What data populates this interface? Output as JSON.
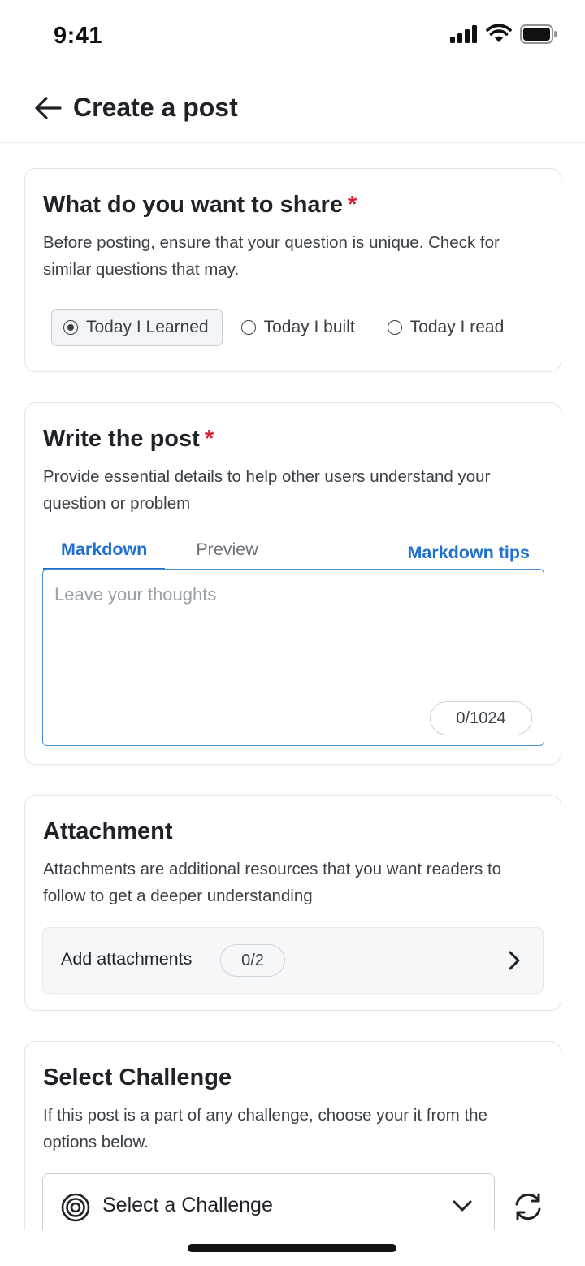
{
  "status_bar": {
    "time": "9:41"
  },
  "header": {
    "title": "Create a post"
  },
  "share_section": {
    "title": "What do you want to share",
    "required_mark": "*",
    "description": "Before posting, ensure that your question is unique. Check for similar questions that may.",
    "options": [
      {
        "label": "Today I Learned",
        "selected": true
      },
      {
        "label": "Today I built",
        "selected": false
      },
      {
        "label": "Today I read",
        "selected": false
      }
    ]
  },
  "write_section": {
    "title": "Write the post",
    "required_mark": "*",
    "description": "Provide essential details to help other users understand your question or problem",
    "tabs": [
      {
        "label": "Markdown",
        "active": true
      },
      {
        "label": "Preview",
        "active": false
      }
    ],
    "tips_link": "Markdown tips",
    "editor": {
      "value": "",
      "placeholder": "Leave your thoughts"
    },
    "char_count": "0/1024"
  },
  "attachment_section": {
    "title": "Attachment",
    "description": "Attachments are additional resources that you want readers to follow to get a deeper understanding",
    "row_label": "Add attachments",
    "count": "0/2"
  },
  "challenge_section": {
    "title": "Select Challenge",
    "description": "If this post is a part of any challenge, choose your it from the options below.",
    "select_label": "Select a Challenge"
  },
  "colors": {
    "accent": "#1e6fd1",
    "required": "#e11d2e",
    "text": "#1f2328",
    "muted": "#3b4046"
  },
  "icons": [
    "signal-icon",
    "wifi-icon",
    "battery-icon",
    "back-arrow-icon",
    "chevron-right-icon",
    "target-icon",
    "chevron-down-icon",
    "refresh-icon"
  ]
}
